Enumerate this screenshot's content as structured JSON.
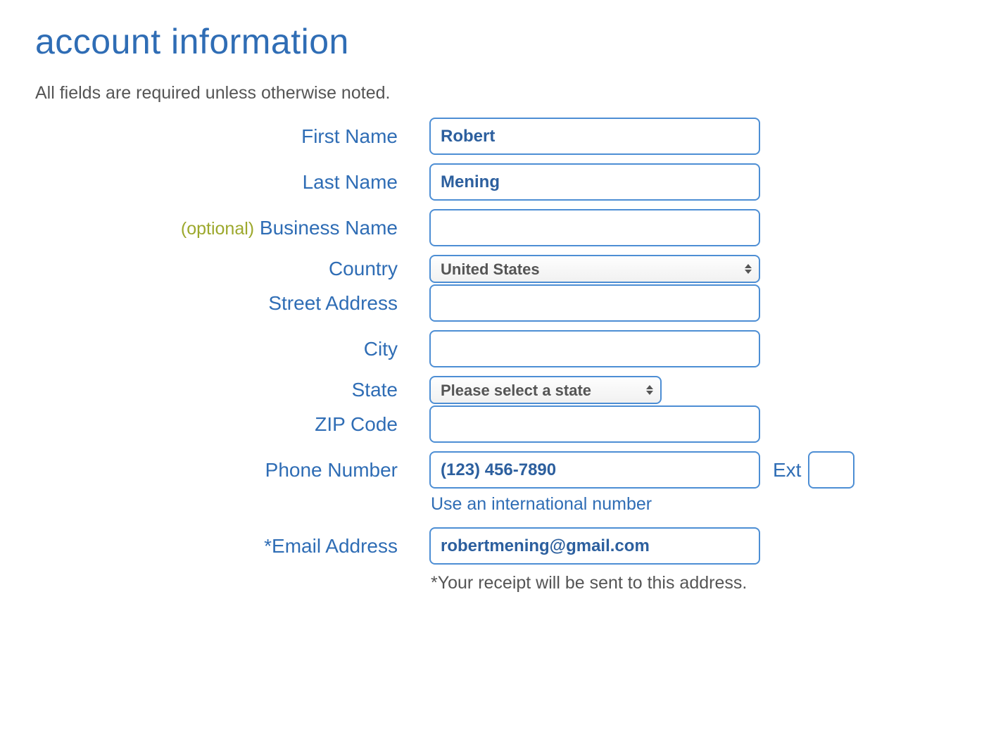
{
  "title": "account information",
  "subtitle": "All fields are required unless otherwise noted.",
  "labels": {
    "first_name": "First Name",
    "last_name": "Last Name",
    "business_name": "Business Name",
    "optional": "(optional)",
    "country": "Country",
    "street": "Street Address",
    "city": "City",
    "state": "State",
    "zip": "ZIP Code",
    "phone": "Phone Number",
    "ext": "Ext",
    "email": "*Email Address"
  },
  "values": {
    "first_name": "Robert",
    "last_name": "Mening",
    "business_name": "",
    "country": "United States",
    "street": "",
    "city": "",
    "state": "Please select a state",
    "zip": "",
    "phone": "(123) 456-7890",
    "ext": "",
    "email": "robertmening@gmail.com"
  },
  "help": {
    "intl": "Use an international number",
    "receipt": "*Your receipt will be sent to this address."
  }
}
